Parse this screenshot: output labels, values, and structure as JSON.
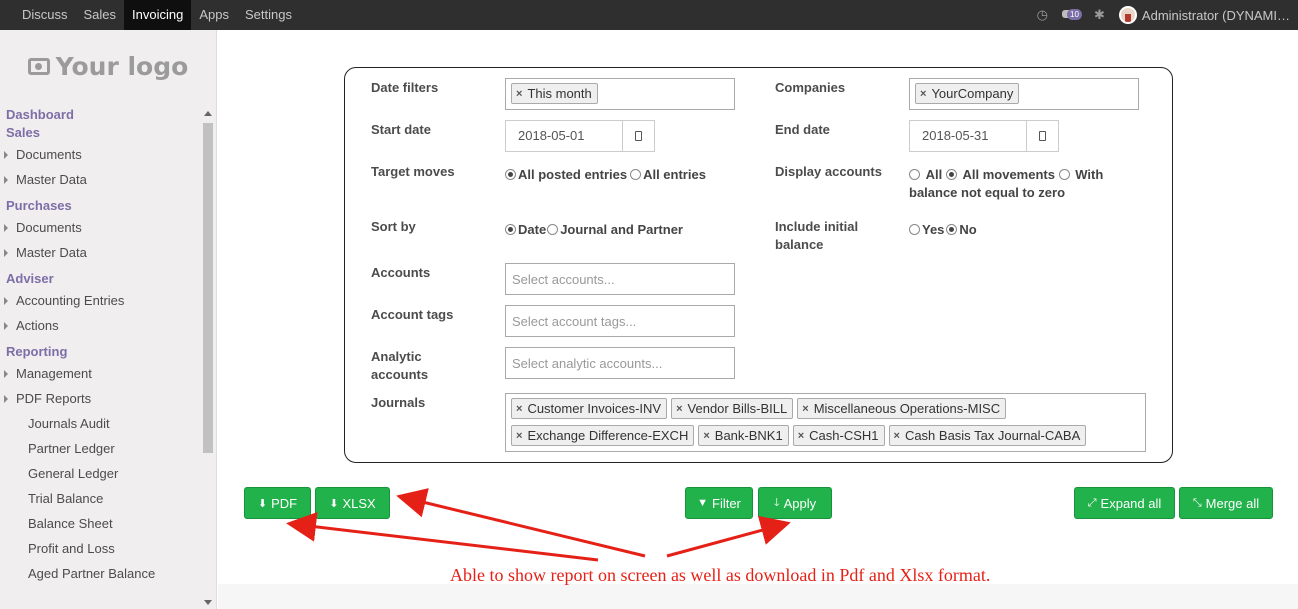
{
  "topbar": {
    "menu": [
      "Discuss",
      "Sales",
      "Invoicing",
      "Apps",
      "Settings"
    ],
    "active": "Invoicing",
    "chat_badge": "10",
    "user": "Administrator (DYNAMI…"
  },
  "sidebar": {
    "logo_text": "Your logo",
    "dashboard": "Dashboard",
    "sales": "Sales",
    "sales_items": [
      "Documents",
      "Master Data"
    ],
    "purchases": "Purchases",
    "purchases_items": [
      "Documents",
      "Master Data"
    ],
    "adviser": "Adviser",
    "adviser_items": [
      "Accounting Entries",
      "Actions"
    ],
    "reporting": "Reporting",
    "reporting_items": [
      "Management",
      "PDF Reports"
    ],
    "pdf_reports": [
      "Journals Audit",
      "Partner Ledger",
      "General Ledger",
      "Trial Balance",
      "Balance Sheet",
      "Profit and Loss",
      "Aged Partner Balance"
    ]
  },
  "form": {
    "date_filters_label": "Date filters",
    "date_filters_tag": "This month",
    "companies_label": "Companies",
    "companies_tag": "YourCompany",
    "start_date_label": "Start date",
    "start_date": "2018-05-01",
    "end_date_label": "End date",
    "end_date": "2018-05-31",
    "target_moves_label": "Target moves",
    "target_moves": [
      "All posted entries",
      "All entries"
    ],
    "display_accounts_label": "Display accounts",
    "display_accounts": [
      "All",
      "All movements",
      "With balance not equal to zero"
    ],
    "sort_by_label": "Sort by",
    "sort_by": [
      "Date",
      "Journal and Partner"
    ],
    "include_initial_label": "Include initial balance",
    "include_initial": [
      "Yes",
      "No"
    ],
    "accounts_label": "Accounts",
    "accounts_placeholder": "Select accounts...",
    "account_tags_label": "Account tags",
    "account_tags_placeholder": "Select account tags...",
    "analytic_label": "Analytic accounts",
    "analytic_placeholder": "Select analytic accounts...",
    "journals_label": "Journals",
    "journals": [
      "Customer Invoices-INV",
      "Vendor Bills-BILL",
      "Miscellaneous Operations-MISC",
      "Exchange Difference-EXCH",
      "Bank-BNK1",
      "Cash-CSH1",
      "Cash Basis Tax Journal-CABA"
    ]
  },
  "buttons": {
    "pdf": "PDF",
    "xlsx": "XLSX",
    "filter": "Filter",
    "apply": "Apply",
    "expand": "Expand all",
    "merge": "Merge all"
  },
  "annotation": "Able to show report on screen as well as download in Pdf and Xlsx format.",
  "colors": {
    "accent": "#7c6fa8",
    "button": "#21b24b",
    "annotation": "#e52117"
  }
}
